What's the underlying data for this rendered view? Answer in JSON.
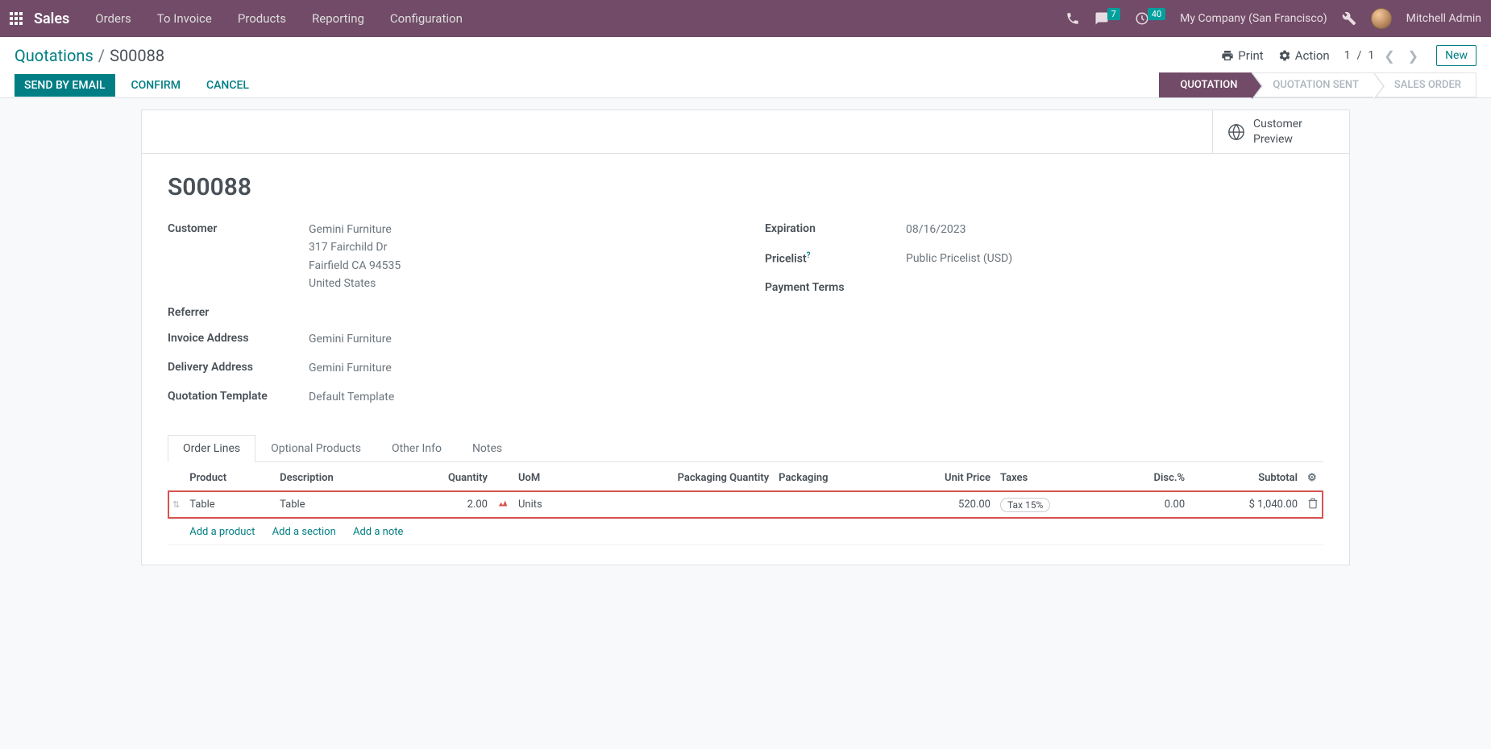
{
  "header": {
    "app_name": "Sales",
    "menu": [
      "Orders",
      "To Invoice",
      "Products",
      "Reporting",
      "Configuration"
    ],
    "discuss_badge": "7",
    "activities_badge": "40",
    "company": "My Company (San Francisco)",
    "user": "Mitchell Admin"
  },
  "breadcrumb": {
    "parent": "Quotations",
    "current": "S00088"
  },
  "cp": {
    "print": "Print",
    "action": "Action",
    "pager_current": "1",
    "pager_total": "1",
    "pager_sep": "/",
    "new": "New"
  },
  "buttons": {
    "send": "SEND BY EMAIL",
    "confirm": "CONFIRM",
    "cancel": "CANCEL"
  },
  "status": {
    "quotation": "QUOTATION",
    "sent": "QUOTATION SENT",
    "order": "SALES ORDER"
  },
  "button_box": {
    "preview_l1": "Customer",
    "preview_l2": "Preview"
  },
  "record": {
    "name": "S00088",
    "labels": {
      "customer": "Customer",
      "referrer": "Referrer",
      "invoice_addr": "Invoice Address",
      "delivery_addr": "Delivery Address",
      "template": "Quotation Template",
      "expiration": "Expiration",
      "pricelist": "Pricelist",
      "payment_terms": "Payment Terms"
    },
    "customer": {
      "name": "Gemini Furniture",
      "street": "317 Fairchild Dr",
      "city_line": "Fairfield CA 94535",
      "country": "United States"
    },
    "invoice_addr": "Gemini Furniture",
    "delivery_addr": "Gemini Furniture",
    "template": "Default Template",
    "expiration": "08/16/2023",
    "pricelist": "Public Pricelist (USD)"
  },
  "tabs": {
    "order_lines": "Order Lines",
    "optional": "Optional Products",
    "other": "Other Info",
    "notes": "Notes"
  },
  "columns": {
    "product": "Product",
    "description": "Description",
    "quantity": "Quantity",
    "uom": "UoM",
    "pack_qty": "Packaging Quantity",
    "packaging": "Packaging",
    "unit_price": "Unit Price",
    "taxes": "Taxes",
    "disc": "Disc.%",
    "subtotal": "Subtotal"
  },
  "line": {
    "product": "Table",
    "description": "Table",
    "quantity": "2.00",
    "uom": "Units",
    "unit_price": "520.00",
    "tax": "Tax 15%",
    "disc": "0.00",
    "subtotal": "$ 1,040.00"
  },
  "add": {
    "product": "Add a product",
    "section": "Add a section",
    "note": "Add a note"
  }
}
